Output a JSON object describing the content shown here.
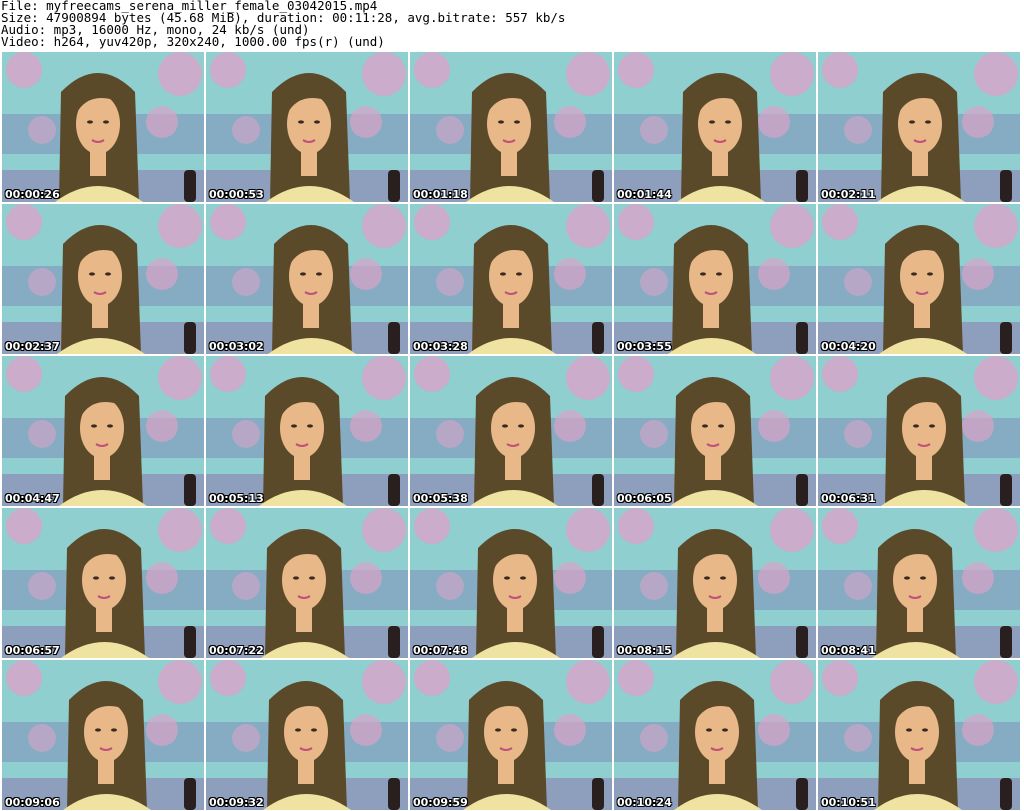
{
  "header": {
    "file": "File: myfreecams_serena_miller_female_03042015.mp4",
    "size": "Size: 47900894 bytes (45.68 MiB), duration: 00:11:28, avg.bitrate: 557 kb/s",
    "audio": "Audio: mp3, 16000 Hz, mono, 24 kb/s (und)",
    "video": "Video: h264, yuv420p, 320x240, 1000.00 fps(r) (und)"
  },
  "thumbnails": [
    "00:00:26",
    "00:00:53",
    "00:01:18",
    "00:01:44",
    "00:02:11",
    "00:02:37",
    "00:03:02",
    "00:03:28",
    "00:03:55",
    "00:04:20",
    "00:04:47",
    "00:05:13",
    "00:05:38",
    "00:06:05",
    "00:06:31",
    "00:06:57",
    "00:07:22",
    "00:07:48",
    "00:08:15",
    "00:08:41",
    "00:09:06",
    "00:09:32",
    "00:09:59",
    "00:10:24",
    "00:10:51"
  ],
  "colors": {
    "background_wall": "#8fcfcf",
    "blossom": "#d9a3c8",
    "hair": "#5a4a2a",
    "skin": "#e8b888",
    "shirt": "#f0e2a0"
  }
}
